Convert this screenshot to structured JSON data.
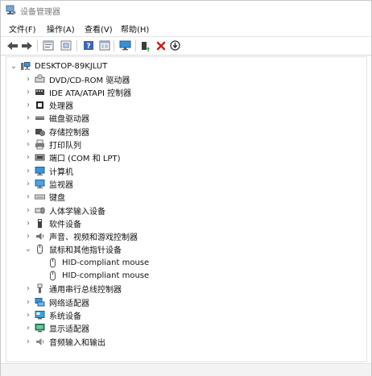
{
  "window": {
    "title": "设备管理器"
  },
  "menu": [
    "文件(F)",
    "操作(A)",
    "查看(V)",
    "帮助(H)"
  ],
  "toolbar": {
    "buttons": [
      "back-icon",
      "forward-icon",
      "properties-icon",
      "show-hidden-icon",
      "help-icon",
      "view-icon",
      "monitor-scan-icon",
      "update-driver-icon",
      "uninstall-icon",
      "disable-icon"
    ]
  },
  "tree": {
    "root": "DESKTOP-89KJLUT",
    "items": [
      {
        "label": "DVD/CD-ROM 驱动器",
        "icon": "dvd-drive-icon"
      },
      {
        "label": "IDE ATA/ATAPI 控制器",
        "icon": "ide-controller-icon"
      },
      {
        "label": "处理器",
        "icon": "processor-icon"
      },
      {
        "label": "磁盘驱动器",
        "icon": "disk-drive-icon"
      },
      {
        "label": "存储控制器",
        "icon": "storage-controller-icon"
      },
      {
        "label": "打印队列",
        "icon": "printer-icon"
      },
      {
        "label": "端口 (COM 和 LPT)",
        "icon": "port-icon"
      },
      {
        "label": "计算机",
        "icon": "computer-icon"
      },
      {
        "label": "监视器",
        "icon": "monitor-icon"
      },
      {
        "label": "键盘",
        "icon": "keyboard-icon"
      },
      {
        "label": "人体学输入设备",
        "icon": "hid-icon"
      },
      {
        "label": "软件设备",
        "icon": "software-device-icon"
      },
      {
        "label": "声音、视频和游戏控制器",
        "icon": "sound-icon"
      },
      {
        "label": "鼠标和其他指针设备",
        "icon": "mouse-category-icon",
        "expanded": true,
        "children": [
          {
            "label": "HID-compliant mouse"
          },
          {
            "label": "HID-compliant mouse"
          }
        ]
      },
      {
        "label": "通用串行总线控制器",
        "icon": "usb-icon"
      },
      {
        "label": "网络适配器",
        "icon": "network-adapter-icon"
      },
      {
        "label": "系统设备",
        "icon": "system-device-icon"
      },
      {
        "label": "显示适配器",
        "icon": "display-adapter-icon"
      },
      {
        "label": "音频输入和输出",
        "icon": "audio-io-icon"
      }
    ]
  }
}
